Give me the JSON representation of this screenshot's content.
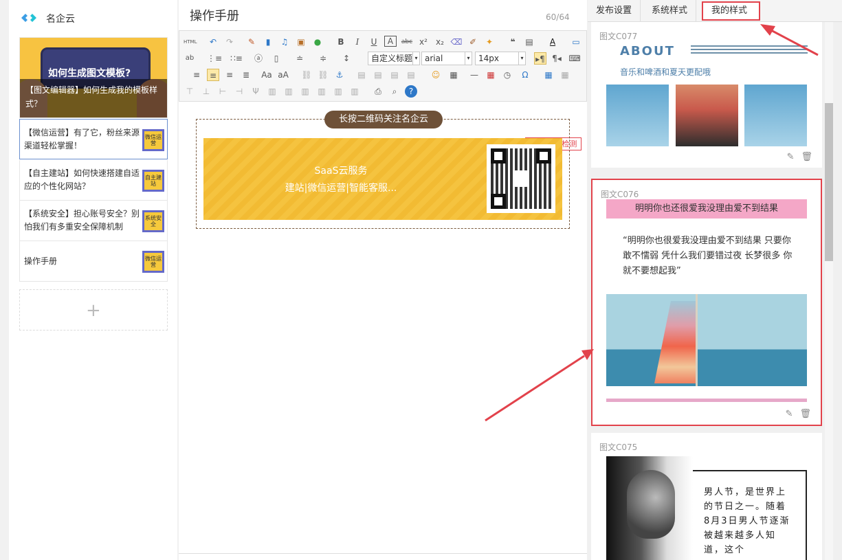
{
  "brand": {
    "name": "名企云"
  },
  "articles": [
    {
      "title": "【图文编辑器】如何生成我的模板样式？",
      "cover_text": "如何生成图文模板?"
    },
    {
      "title": "【微信运营】有了它，粉丝来源渠道轻松掌握！",
      "thumb": "微信运营"
    },
    {
      "title": "【自主建站】如何快速搭建自适应的个性化网站？",
      "thumb": "自主建站"
    },
    {
      "title": "【系统安全】担心账号安全？别怕我们有多重安全保障机制",
      "thumb": "系统安全"
    },
    {
      "title": "操作手册",
      "thumb": "微信运营"
    }
  ],
  "editor": {
    "title": "操作手册",
    "counter": "60/64",
    "font_style": "自定义标题",
    "font_family": "arial",
    "font_size": "14px",
    "typo_check": "错别字检测",
    "follow_pill": "长按二维码关注名企云",
    "saas_line1": "SaaS云服务",
    "saas_line2": "建站|微信运营|智能客服..."
  },
  "tabs": [
    {
      "label": "发布设置"
    },
    {
      "label": "系统样式"
    },
    {
      "label": "我的样式"
    }
  ],
  "styles": {
    "c077": {
      "label": "图文C077",
      "heading": "ABOUT",
      "sub": "音乐和啤酒和夏天更配哦"
    },
    "c076": {
      "label": "图文C076",
      "bar": "明明你也还很爱我没理由爱不到结果",
      "poem": "“明明你也很爱我没理由爱不到结果 只要你敢不懦弱 凭什么我们要错过夜 长梦很多 你就不要想起我”"
    },
    "c075": {
      "label": "图文C075",
      "text": "男人节，是世界上的节日之一。随着8月3日男人节逐渐被越来越多人知道，这个"
    }
  },
  "colors": {
    "accent_red": "#e2424b",
    "brown": "#6e5138",
    "yellow": "#f5c33f",
    "pink": "#f4a7c7"
  }
}
